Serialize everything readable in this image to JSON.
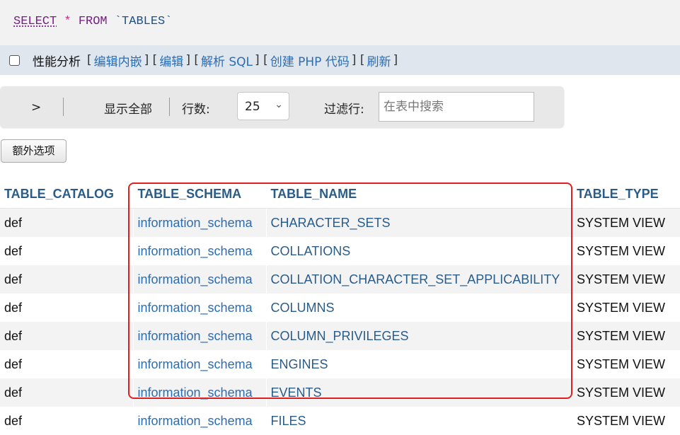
{
  "sql": {
    "select": "SELECT",
    "star": "*",
    "from": "FROM",
    "table": "`TABLES`"
  },
  "profiling": {
    "label": "性能分析",
    "links": [
      "编辑内嵌",
      "编辑",
      "解析 SQL",
      "创建 PHP 代码",
      "刷新"
    ]
  },
  "nav": {
    "next": ">",
    "show_all": "显示全部",
    "rows_label": "行数:",
    "rows_value": "25",
    "filter_label": "过滤行:",
    "filter_placeholder": "在表中搜索"
  },
  "extra_options": "额外选项",
  "table": {
    "columns": [
      "TABLE_CATALOG",
      "TABLE_SCHEMA",
      "TABLE_NAME",
      "TABLE_TYPE"
    ],
    "rows": [
      [
        "def",
        "information_schema",
        "CHARACTER_SETS",
        "SYSTEM VIEW"
      ],
      [
        "def",
        "information_schema",
        "COLLATIONS",
        "SYSTEM VIEW"
      ],
      [
        "def",
        "information_schema",
        "COLLATION_CHARACTER_SET_APPLICABILITY",
        "SYSTEM VIEW"
      ],
      [
        "def",
        "information_schema",
        "COLUMNS",
        "SYSTEM VIEW"
      ],
      [
        "def",
        "information_schema",
        "COLUMN_PRIVILEGES",
        "SYSTEM VIEW"
      ],
      [
        "def",
        "information_schema",
        "ENGINES",
        "SYSTEM VIEW"
      ],
      [
        "def",
        "information_schema",
        "EVENTS",
        "SYSTEM VIEW"
      ],
      [
        "def",
        "information_schema",
        "FILES",
        "SYSTEM VIEW"
      ]
    ]
  },
  "colors": {
    "highlight": "#e02020",
    "link": "#2a6db5",
    "header": "#2a5c8a"
  }
}
